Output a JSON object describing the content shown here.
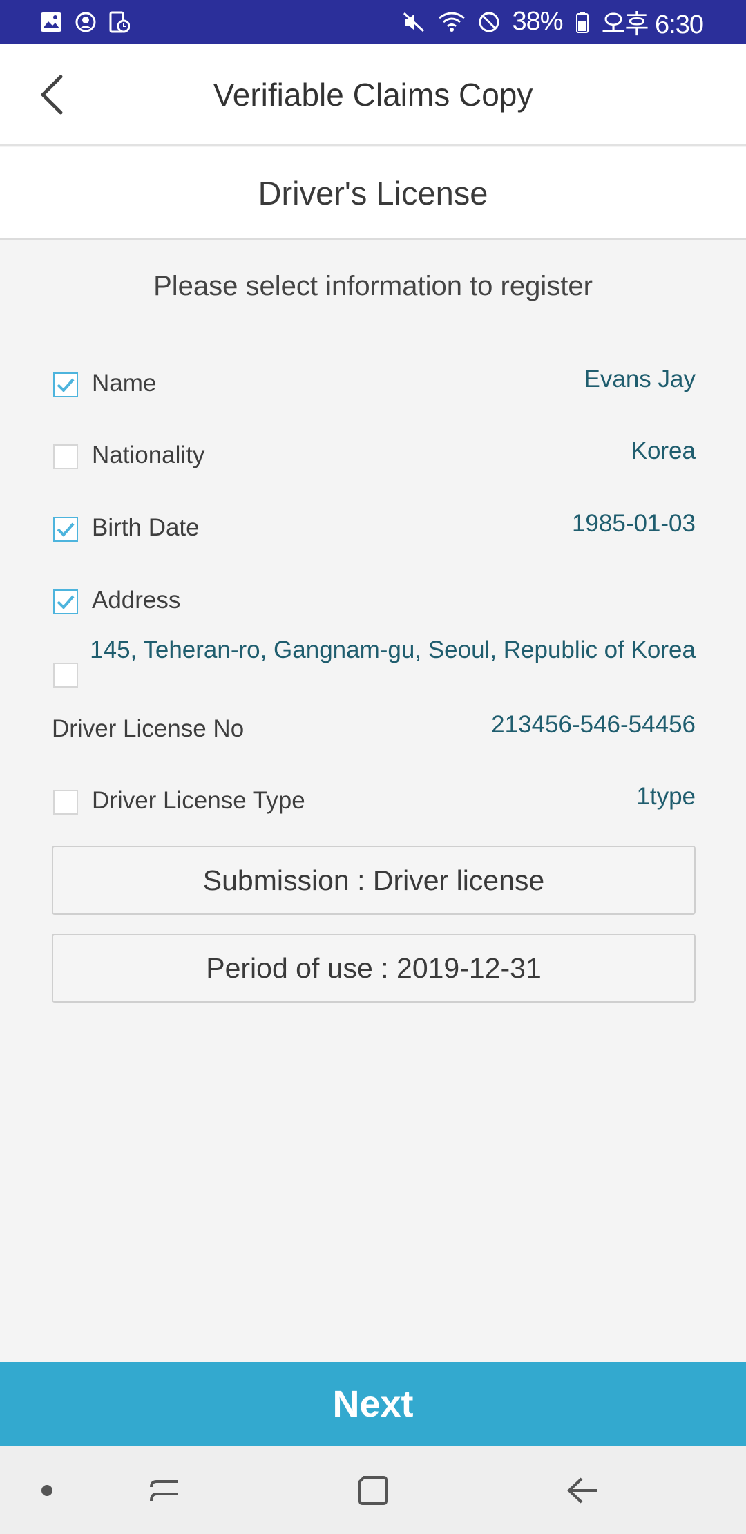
{
  "status_bar": {
    "battery": "38%",
    "time": "오후 6:30",
    "left_icons": [
      "gallery-icon",
      "account-circle-icon",
      "device-clock-icon"
    ],
    "right_icons": [
      "mute-icon",
      "wifi-icon",
      "do-not-disturb-icon",
      "battery-icon"
    ]
  },
  "header": {
    "title": "Verifiable Claims Copy",
    "back_icon": "chevron-left-icon"
  },
  "section": {
    "title": "Driver's License"
  },
  "instruction": "Please select information to register",
  "fields": [
    {
      "label": "Name",
      "value": "Evans Jay",
      "checked": true
    },
    {
      "label": "Nationality",
      "value": "Korea",
      "checked": false
    },
    {
      "label": "Birth Date",
      "value": "1985-01-03",
      "checked": true
    },
    {
      "label": "Address",
      "value": "",
      "checked": true
    },
    {
      "label": "",
      "value": "145, Teheran-ro, Gangnam-gu, Seoul, Republic of Korea",
      "checked": false
    },
    {
      "label": "Driver License No",
      "value": "213456-546-54456"
    },
    {
      "label": "Driver License Type",
      "value": "1type",
      "checked": false
    }
  ],
  "submission": "Submission : Driver license",
  "period": "Period of use : 2019-12-31",
  "next_button": "Next",
  "nav_bar": {
    "icons": [
      "dot-icon",
      "recent-apps-icon",
      "home-icon",
      "back-arrow-icon"
    ]
  },
  "colors": {
    "status_bar": "#2b2f9a",
    "accent": "#33a9cf",
    "checkbox_checked": "#4db4dd",
    "value_text": "#1f5d6e"
  }
}
